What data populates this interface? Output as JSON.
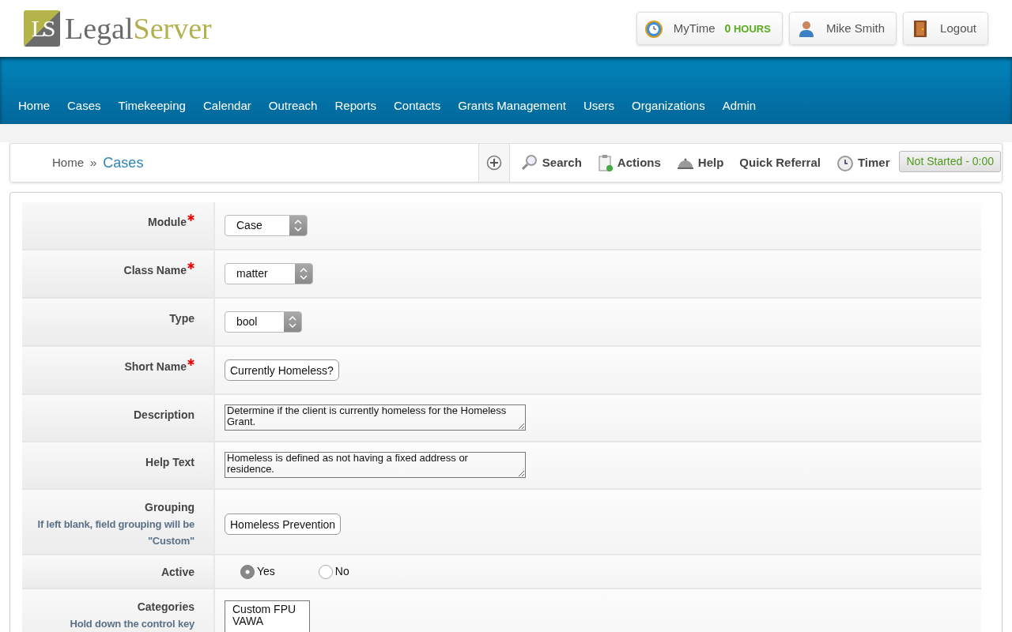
{
  "logo": {
    "mark": "LS",
    "name_part1": "Legal",
    "name_part2": "Server"
  },
  "header_buttons": [
    {
      "kind": "mytime",
      "label": "MyTime",
      "value": "0",
      "unit": "HOURS"
    },
    {
      "kind": "user",
      "label": "Mike Smith"
    },
    {
      "kind": "logout",
      "label": "Logout"
    }
  ],
  "nav": [
    "Home",
    "Cases",
    "Timekeeping",
    "Calendar",
    "Outreach",
    "Reports",
    "Contacts",
    "Grants Management",
    "Users",
    "Organizations",
    "Admin"
  ],
  "breadcrumb": [
    {
      "label": "Home",
      "current": false
    },
    {
      "separator": "»",
      "label": "Cases",
      "current": true
    }
  ],
  "toolbar": [
    {
      "kind": "search",
      "label": "Search"
    },
    {
      "kind": "actions",
      "label": "Actions"
    },
    {
      "kind": "help",
      "label": "Help"
    },
    {
      "kind": "plain",
      "label": "Quick Referral"
    },
    {
      "kind": "timer",
      "label": "Timer"
    }
  ],
  "timer_status": "Not Started - 0:00",
  "form": [
    {
      "label": "Module",
      "required": true,
      "kind": "select",
      "value": "Case"
    },
    {
      "label": "Class Name",
      "required": true,
      "kind": "select",
      "value": "matter"
    },
    {
      "label": "Type",
      "kind": "select",
      "value": "bool"
    },
    {
      "label": "Short Name",
      "required": true,
      "kind": "text",
      "value": "Currently Homeless?"
    },
    {
      "label": "Description",
      "kind": "textarea",
      "value": "Determine if the client is currently homeless for the Homeless Grant."
    },
    {
      "label": "Help Text",
      "kind": "textarea",
      "value": "Homeless is defined as not having a fixed address or residence."
    },
    {
      "label": "Grouping",
      "hint": "If left blank, field grouping will be \"Custom\"",
      "kind": "text",
      "value": "Homeless Prevention"
    },
    {
      "label": "Active",
      "kind": "radio",
      "options": [
        {
          "label": "Yes",
          "selected": true
        },
        {
          "label": "No",
          "selected": false
        }
      ]
    },
    {
      "label": "Categories",
      "hint": "Hold down the control key",
      "kind": "multiselect",
      "options": [
        "Custom FPU",
        "VAWA"
      ]
    }
  ]
}
